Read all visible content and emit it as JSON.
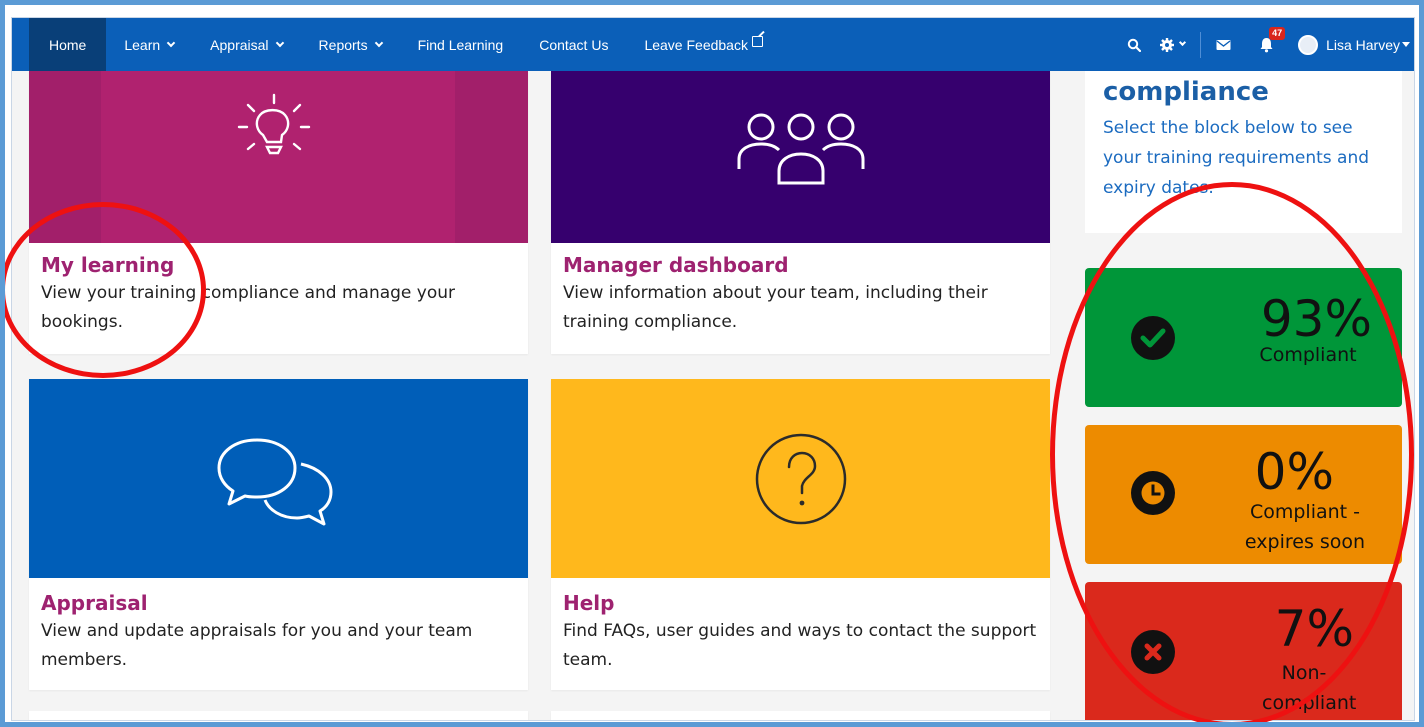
{
  "nav": {
    "home": "Home",
    "learn": "Learn",
    "appraisal": "Appraisal",
    "reports": "Reports",
    "find_learning": "Find Learning",
    "contact_us": "Contact Us",
    "leave_feedback": "Leave Feedback",
    "notification_count": "47",
    "user_name": "Lisa Harvey",
    "icons": [
      "search-icon",
      "gear-icon",
      "envelope-icon",
      "bell-icon",
      "avatar"
    ]
  },
  "cards": {
    "my_learning": {
      "title": "My learning",
      "description": "View your training compliance and manage your bookings.",
      "color": "#b0226f"
    },
    "manager_dashboard": {
      "title": "Manager dashboard",
      "description": "View information about your team, including their training compliance.",
      "color": "#36006e"
    },
    "appraisal": {
      "title": "Appraisal",
      "description": "View and update appraisals for you and your team members.",
      "color": "#005eb8"
    },
    "help": {
      "title": "Help",
      "description": "Find FAQs, user guides and ways to contact the support team.",
      "color": "#ffb81c"
    }
  },
  "sidebar": {
    "heading": "compliance",
    "description": "Select the block below to see your training requirements and expiry dates.",
    "stats": [
      {
        "value": "93%",
        "label": "Compliant",
        "color": "#009639"
      },
      {
        "value": "0%",
        "label": "Compliant - expires soon",
        "color": "#ed8b00"
      },
      {
        "value": "7%",
        "label": "Non-compliant",
        "color": "#da291c"
      }
    ]
  }
}
